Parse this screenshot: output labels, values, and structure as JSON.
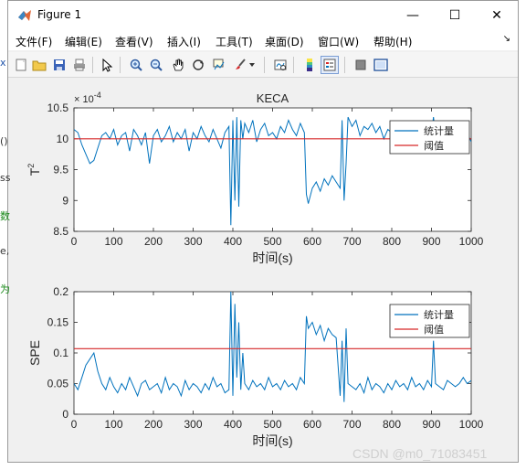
{
  "window": {
    "title": "Figure 1"
  },
  "title_buttons": {
    "minimize": "—",
    "maximize": "☐",
    "close": "✕"
  },
  "menu": [
    {
      "label": "文件(F)"
    },
    {
      "label": "编辑(E)"
    },
    {
      "label": "查看(V)"
    },
    {
      "label": "插入(I)"
    },
    {
      "label": "工具(T)"
    },
    {
      "label": "桌面(D)"
    },
    {
      "label": "窗口(W)"
    },
    {
      "label": "帮助(H)"
    }
  ],
  "menu_arrow": "↘",
  "toolbar_icons": [
    "new-figure-icon",
    "open-file-icon",
    "save-icon",
    "print-icon",
    "pointer-icon",
    "zoom-in-icon",
    "zoom-out-icon",
    "pan-icon",
    "rotate-3d-icon",
    "data-cursor-icon",
    "brush-icon",
    "brush-dropdown-icon",
    "link-plot-icon",
    "colorbar-icon",
    "legend-icon",
    "hide-plot-tools-icon",
    "show-plot-tools-icon"
  ],
  "background_fragments": [
    "x",
    "()",
    "ss",
    "数",
    "e,",
    "为"
  ],
  "watermark": "CSDN @m0_71083451",
  "colors": {
    "series": "#0072bd",
    "threshold": "#d62728",
    "axes": "#262626"
  },
  "chart_data": [
    {
      "type": "line",
      "title": "KECA",
      "xlabel": "时间(s)",
      "ylabel_base": "T",
      "ylabel_sup": "2",
      "yexp_base": "× 10",
      "yexp_sup": "-4",
      "xlim": [
        0,
        1000
      ],
      "ylim": [
        8.5,
        10.5
      ],
      "xticks": [
        0,
        100,
        200,
        300,
        400,
        500,
        600,
        700,
        800,
        900,
        1000
      ],
      "yticks": [
        8.5,
        9,
        9.5,
        10,
        10.5
      ],
      "legend": [
        "统计量",
        "阈值"
      ],
      "legend_position": "top-right",
      "threshold": 10.0,
      "series": [
        {
          "name": "统计量",
          "x": [
            0,
            10,
            20,
            30,
            40,
            50,
            60,
            70,
            80,
            90,
            100,
            110,
            120,
            130,
            140,
            150,
            160,
            170,
            180,
            190,
            200,
            210,
            220,
            230,
            240,
            250,
            260,
            270,
            280,
            290,
            300,
            310,
            320,
            330,
            340,
            350,
            360,
            370,
            380,
            390,
            395,
            400,
            405,
            410,
            415,
            420,
            425,
            430,
            440,
            450,
            460,
            470,
            480,
            490,
            500,
            510,
            520,
            530,
            540,
            550,
            560,
            570,
            580,
            585,
            590,
            600,
            610,
            620,
            630,
            640,
            650,
            660,
            670,
            675,
            680,
            685,
            690,
            700,
            710,
            720,
            730,
            740,
            750,
            760,
            770,
            780,
            790,
            800,
            810,
            820,
            830,
            840,
            850,
            860,
            870,
            880,
            890,
            900,
            905,
            910,
            920,
            930,
            940,
            950,
            960,
            970,
            980,
            990,
            1000
          ],
          "y": [
            10.15,
            10.1,
            9.9,
            9.75,
            9.6,
            9.65,
            9.85,
            10.05,
            10.1,
            10.0,
            10.15,
            9.9,
            10.05,
            10.1,
            9.8,
            10.15,
            10.05,
            9.9,
            10.1,
            9.6,
            10.05,
            10.15,
            9.95,
            10.05,
            10.2,
            9.95,
            10.1,
            10.0,
            10.15,
            9.8,
            10.1,
            10.0,
            10.2,
            10.05,
            9.95,
            10.15,
            10.0,
            9.85,
            10.1,
            10.2,
            8.6,
            10.3,
            9.0,
            10.35,
            8.9,
            10.3,
            10.0,
            10.25,
            10.1,
            10.3,
            9.95,
            10.15,
            10.25,
            10.05,
            10.1,
            10.0,
            10.2,
            10.1,
            10.3,
            10.15,
            10.05,
            10.25,
            10.1,
            9.1,
            8.95,
            9.2,
            9.3,
            9.15,
            9.35,
            9.25,
            9.4,
            9.3,
            9.2,
            10.3,
            9.0,
            9.6,
            10.35,
            10.2,
            10.3,
            10.05,
            10.2,
            10.15,
            10.25,
            10.1,
            10.2,
            10.0,
            10.15,
            10.1,
            10.05,
            10.2,
            10.0,
            9.95,
            10.1,
            10.05,
            9.9,
            10.05,
            10.0,
            10.1,
            10.35,
            10.05,
            10.0,
            10.1,
            9.95,
            10.05,
            10.1,
            10.0,
            10.05,
            10.1,
            9.95
          ]
        },
        {
          "name": "阈值",
          "x": [
            0,
            1000
          ],
          "y": [
            10.0,
            10.0
          ]
        }
      ]
    },
    {
      "type": "line",
      "title": "",
      "xlabel": "时间(s)",
      "ylabel": "SPE",
      "xlim": [
        0,
        1000
      ],
      "ylim": [
        0,
        0.2
      ],
      "xticks": [
        0,
        100,
        200,
        300,
        400,
        500,
        600,
        700,
        800,
        900,
        1000
      ],
      "yticks": [
        0,
        0.05,
        0.1,
        0.15,
        0.2
      ],
      "legend": [
        "统计量",
        "阈值"
      ],
      "legend_position": "top-right",
      "threshold": 0.107,
      "series": [
        {
          "name": "统计量",
          "x": [
            0,
            10,
            20,
            30,
            40,
            50,
            60,
            70,
            80,
            90,
            100,
            110,
            120,
            130,
            140,
            150,
            160,
            170,
            180,
            190,
            200,
            210,
            220,
            230,
            240,
            250,
            260,
            270,
            280,
            290,
            300,
            310,
            320,
            330,
            340,
            350,
            360,
            370,
            380,
            390,
            395,
            400,
            405,
            410,
            415,
            420,
            425,
            430,
            440,
            450,
            460,
            470,
            480,
            490,
            500,
            510,
            520,
            530,
            540,
            550,
            560,
            570,
            580,
            585,
            590,
            600,
            610,
            620,
            630,
            640,
            650,
            660,
            670,
            675,
            680,
            685,
            690,
            700,
            710,
            720,
            730,
            740,
            750,
            760,
            770,
            780,
            790,
            800,
            810,
            820,
            830,
            840,
            850,
            860,
            870,
            880,
            890,
            900,
            905,
            910,
            920,
            930,
            940,
            950,
            960,
            970,
            980,
            990,
            1000
          ],
          "y": [
            0.05,
            0.04,
            0.06,
            0.08,
            0.09,
            0.1,
            0.07,
            0.05,
            0.04,
            0.06,
            0.045,
            0.035,
            0.05,
            0.04,
            0.06,
            0.045,
            0.03,
            0.05,
            0.055,
            0.04,
            0.045,
            0.05,
            0.035,
            0.06,
            0.04,
            0.05,
            0.045,
            0.03,
            0.055,
            0.04,
            0.05,
            0.045,
            0.035,
            0.05,
            0.04,
            0.06,
            0.045,
            0.05,
            0.035,
            0.04,
            0.2,
            0.03,
            0.18,
            0.06,
            0.15,
            0.04,
            0.1,
            0.05,
            0.04,
            0.055,
            0.045,
            0.05,
            0.04,
            0.06,
            0.045,
            0.05,
            0.04,
            0.055,
            0.045,
            0.05,
            0.04,
            0.06,
            0.05,
            0.16,
            0.14,
            0.15,
            0.13,
            0.145,
            0.12,
            0.14,
            0.13,
            0.125,
            0.03,
            0.12,
            0.02,
            0.14,
            0.05,
            0.045,
            0.04,
            0.05,
            0.035,
            0.06,
            0.04,
            0.05,
            0.045,
            0.035,
            0.05,
            0.04,
            0.055,
            0.045,
            0.05,
            0.04,
            0.06,
            0.045,
            0.05,
            0.04,
            0.055,
            0.045,
            0.12,
            0.05,
            0.045,
            0.04,
            0.055,
            0.05,
            0.045,
            0.05,
            0.06,
            0.05,
            0.055
          ]
        },
        {
          "name": "阈值",
          "x": [
            0,
            1000
          ],
          "y": [
            0.107,
            0.107
          ]
        }
      ]
    }
  ]
}
